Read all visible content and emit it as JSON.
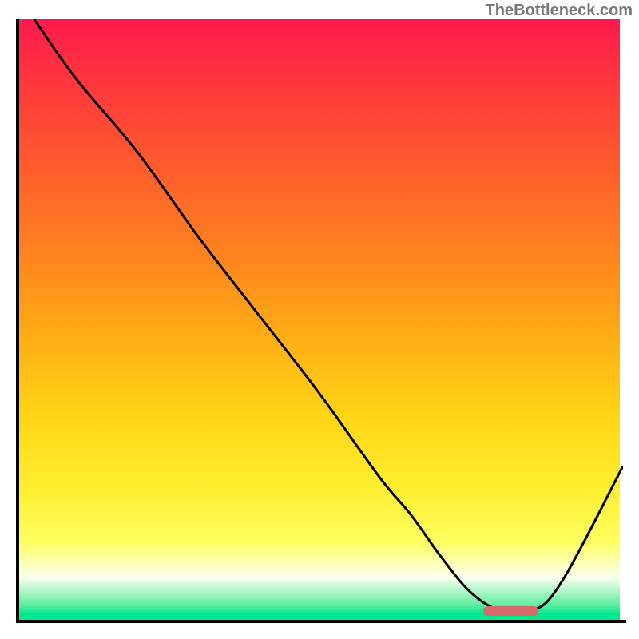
{
  "watermark": "TheBottleneck.com",
  "chart_data": {
    "type": "line",
    "title": "",
    "xlabel": "",
    "ylabel": "",
    "xlim": [
      0,
      100
    ],
    "ylim": [
      0,
      100
    ],
    "x": [
      3,
      10,
      20,
      30,
      40,
      50,
      60,
      65,
      70,
      75,
      80,
      85,
      90,
      100
    ],
    "values": [
      100,
      90,
      78,
      64,
      51,
      38,
      24,
      18,
      11,
      5,
      2,
      2,
      7,
      26
    ],
    "annotations": [
      {
        "type": "marker",
        "x_start": 77,
        "x_end": 86,
        "y": 2,
        "color": "#d86a6a"
      }
    ],
    "background_gradient_stops": [
      {
        "pct": 0,
        "color": "#ff1a4d"
      },
      {
        "pct": 50,
        "color": "#ffaa15"
      },
      {
        "pct": 88,
        "color": "#ffff60"
      },
      {
        "pct": 100,
        "color": "#00e890"
      }
    ]
  },
  "plot_geometry": {
    "inner_width": 760,
    "inner_height": 756
  }
}
